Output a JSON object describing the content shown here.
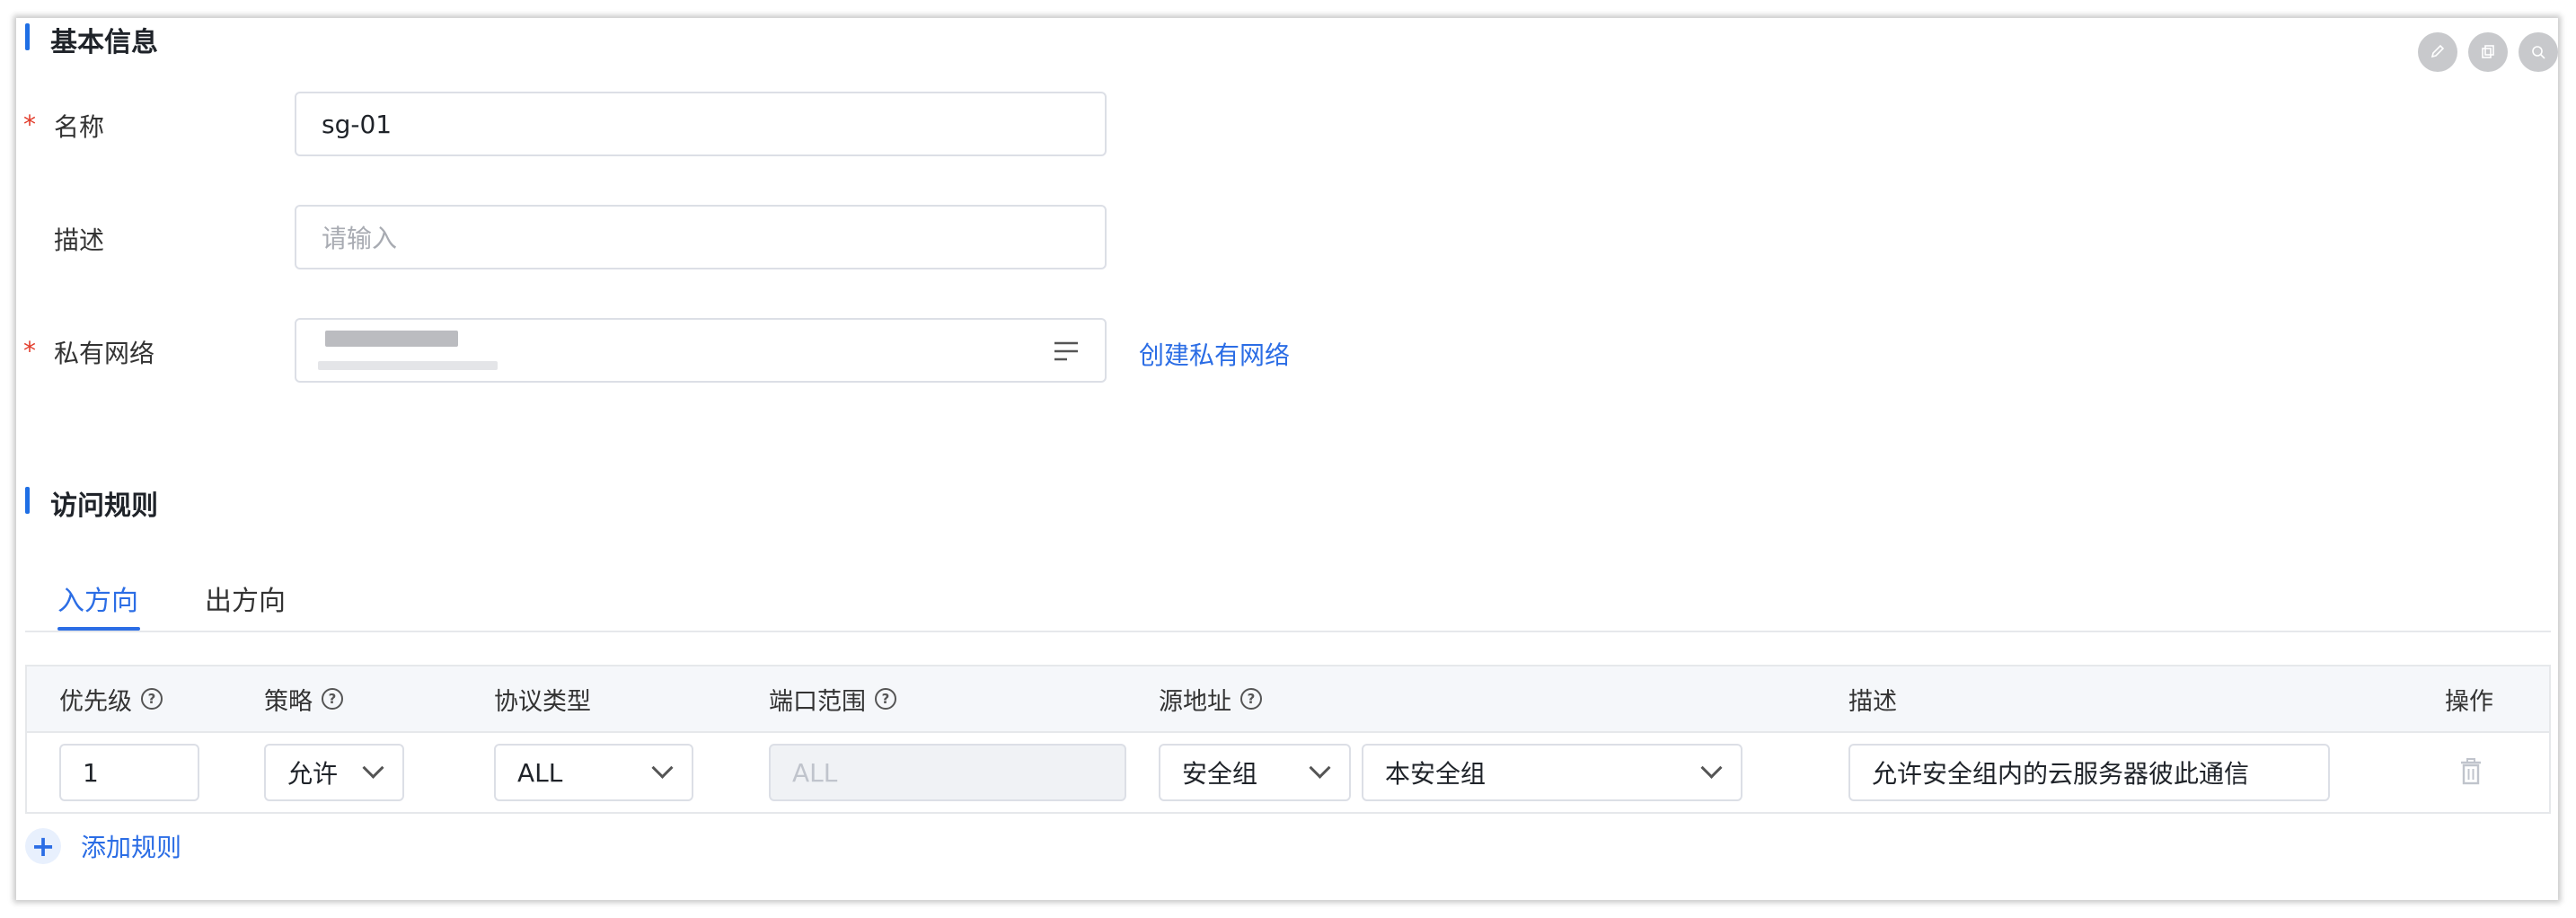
{
  "basic_info": {
    "section_title": "基本信息",
    "name_label": "名称",
    "name_value": "sg-01",
    "desc_label": "描述",
    "desc_placeholder": "请输入",
    "vpc_label": "私有网络",
    "create_vpc_link": "创建私有网络",
    "required_mark": "*"
  },
  "access_rules": {
    "section_title": "访问规则",
    "tabs": [
      {
        "label": "入方向",
        "active": true
      },
      {
        "label": "出方向",
        "active": false
      }
    ],
    "columns": [
      "优先级",
      "策略",
      "协议类型",
      "端口范围",
      "源地址",
      "描述",
      "操作"
    ],
    "rows": [
      {
        "priority": "1",
        "policy": "允许",
        "protocol": "ALL",
        "port_range": "ALL",
        "source_type": "安全组",
        "source_value": "本安全组",
        "description": "允许安全组内的云服务器彼此通信"
      }
    ],
    "add_rule_label": "添加规则"
  },
  "icons": {
    "help": "?",
    "add": "+",
    "delete": "trash-icon",
    "list": "list-icon"
  },
  "colors": {
    "accent": "#2b6de5",
    "required": "#e23c2b",
    "section_bar": "#1f6fe5"
  }
}
